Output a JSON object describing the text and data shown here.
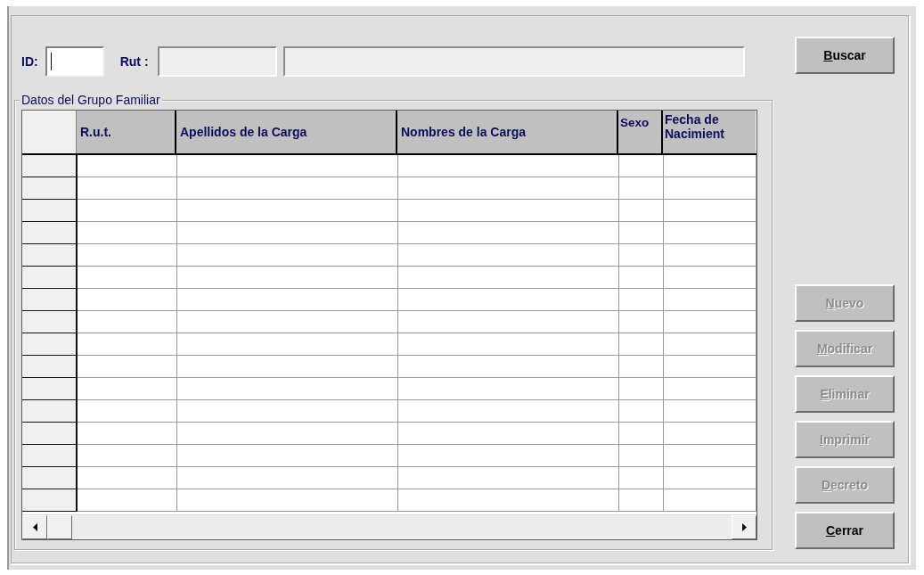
{
  "search": {
    "id_label": "ID:",
    "id_field": {
      "focused": true
    },
    "rut_label": "Rut :",
    "rut_field": {
      "disabled": true
    },
    "name_field": {
      "disabled": true
    }
  },
  "search_button": {
    "label": "Buscar",
    "underline_first": true,
    "disabled": false
  },
  "group": {
    "title": "Datos del Grupo Familiar",
    "table": {
      "columns": [
        "R.u.t.",
        "Apellidos de la Carga",
        "Nombres de la Carga",
        "Sexo",
        "Fecha de Nacimient"
      ]
    }
  },
  "buttons": [
    {
      "label": "Nuevo",
      "underline_first": true,
      "disabled": true
    },
    {
      "label": "Modificar",
      "underline_first": true,
      "disabled": true
    },
    {
      "label": "Eliminar",
      "underline_first": true,
      "disabled": true
    },
    {
      "label": "Imprimir",
      "underline_first": true,
      "disabled": true
    },
    {
      "label": "Decreto",
      "underline_first": true,
      "disabled": true
    },
    {
      "label": "Cerrar",
      "underline_first": true,
      "disabled": false
    }
  ]
}
